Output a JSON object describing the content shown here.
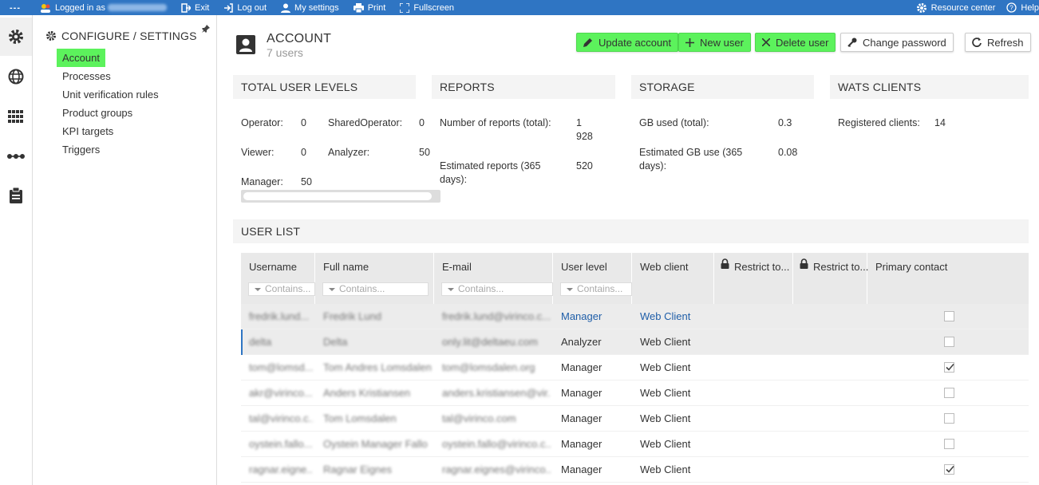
{
  "topbar": {
    "menu": "---",
    "logged_in_as": "Logged in as",
    "exit": "Exit",
    "log_out": "Log out",
    "my_settings": "My settings",
    "print": "Print",
    "fullscreen": "Fullscreen",
    "resource_center": "Resource center",
    "help": "Help"
  },
  "sidebar": {
    "title": "CONFIGURE / SETTINGS",
    "items": [
      {
        "label": "Account",
        "active": true
      },
      {
        "label": "Processes"
      },
      {
        "label": "Unit verification rules"
      },
      {
        "label": "Product groups"
      },
      {
        "label": "KPI targets"
      },
      {
        "label": "Triggers"
      }
    ]
  },
  "header": {
    "title": "ACCOUNT",
    "subtitle": "7 users"
  },
  "toolbar": {
    "update_account": "Update account",
    "new_user": "New user",
    "delete_user": "Delete user",
    "change_password": "Change password",
    "refresh": "Refresh"
  },
  "levels": {
    "title": "TOTAL USER LEVELS",
    "operator_label": "Operator:",
    "operator_value": "0",
    "shared_label": "SharedOperator:",
    "shared_value": "0",
    "viewer_label": "Viewer:",
    "viewer_value": "0",
    "analyzer_label": "Analyzer:",
    "analyzer_value": "50",
    "manager_label": "Manager:",
    "manager_value": "50"
  },
  "reports": {
    "title": "REPORTS",
    "total_label": "Number of reports (total):",
    "total_value_1": "1",
    "total_value_2": "928",
    "est_label_1": "Estimated reports (365",
    "est_label_2": "days):",
    "est_value": "520"
  },
  "storage": {
    "title": "STORAGE",
    "used_label": "GB used (total):",
    "used_value": "0.3",
    "est_label_1": "Estimated GB use (365",
    "est_label_2": "days):",
    "est_value": "0.08"
  },
  "clients": {
    "title": "WATS CLIENTS",
    "registered_label": "Registered clients:",
    "registered_value": "14"
  },
  "user_list": {
    "title": "USER LIST",
    "columns": {
      "username": "Username",
      "full_name": "Full name",
      "email": "E-mail",
      "user_level": "User level",
      "web_client": "Web client",
      "restrict1": "Restrict to...",
      "restrict2": "Restrict to...",
      "primary": "Primary contact"
    },
    "filter_placeholder": "Contains...",
    "rows": [
      {
        "username": "fredrik.lund...",
        "full_name": "Fredrik Lund",
        "email": "fredrik.lund@virinco.c...",
        "level": "Manager",
        "web": "Web Client",
        "primary": false
      },
      {
        "username": "delta",
        "full_name": "Delta",
        "email": "only.lit@deltaeu.com",
        "level": "Analyzer",
        "web": "Web Client",
        "primary": false
      },
      {
        "username": "tom@lomsd...",
        "full_name": "Tom Andres Lomsdalen",
        "email": "tom@lomsdalen.org",
        "level": "Manager",
        "web": "Web Client",
        "primary": true
      },
      {
        "username": "akr@virinco...",
        "full_name": "Anders Kristiansen",
        "email": "anders.kristiansen@vir...",
        "level": "Manager",
        "web": "Web Client",
        "primary": false
      },
      {
        "username": "tal@virinco.c...",
        "full_name": "Tom Lomsdalen",
        "email": "tal@virinco.com",
        "level": "Manager",
        "web": "Web Client",
        "primary": false
      },
      {
        "username": "oystein.fallo...",
        "full_name": "Oystein Manager Fallo",
        "email": "oystein.fallo@virinco.c...",
        "level": "Manager",
        "web": "Web Client",
        "primary": false
      },
      {
        "username": "ragnar.eigne...",
        "full_name": "Ragnar Eignes",
        "email": "ragnar.eignes@virinco...",
        "level": "Manager",
        "web": "Web Client",
        "primary": true
      }
    ]
  }
}
